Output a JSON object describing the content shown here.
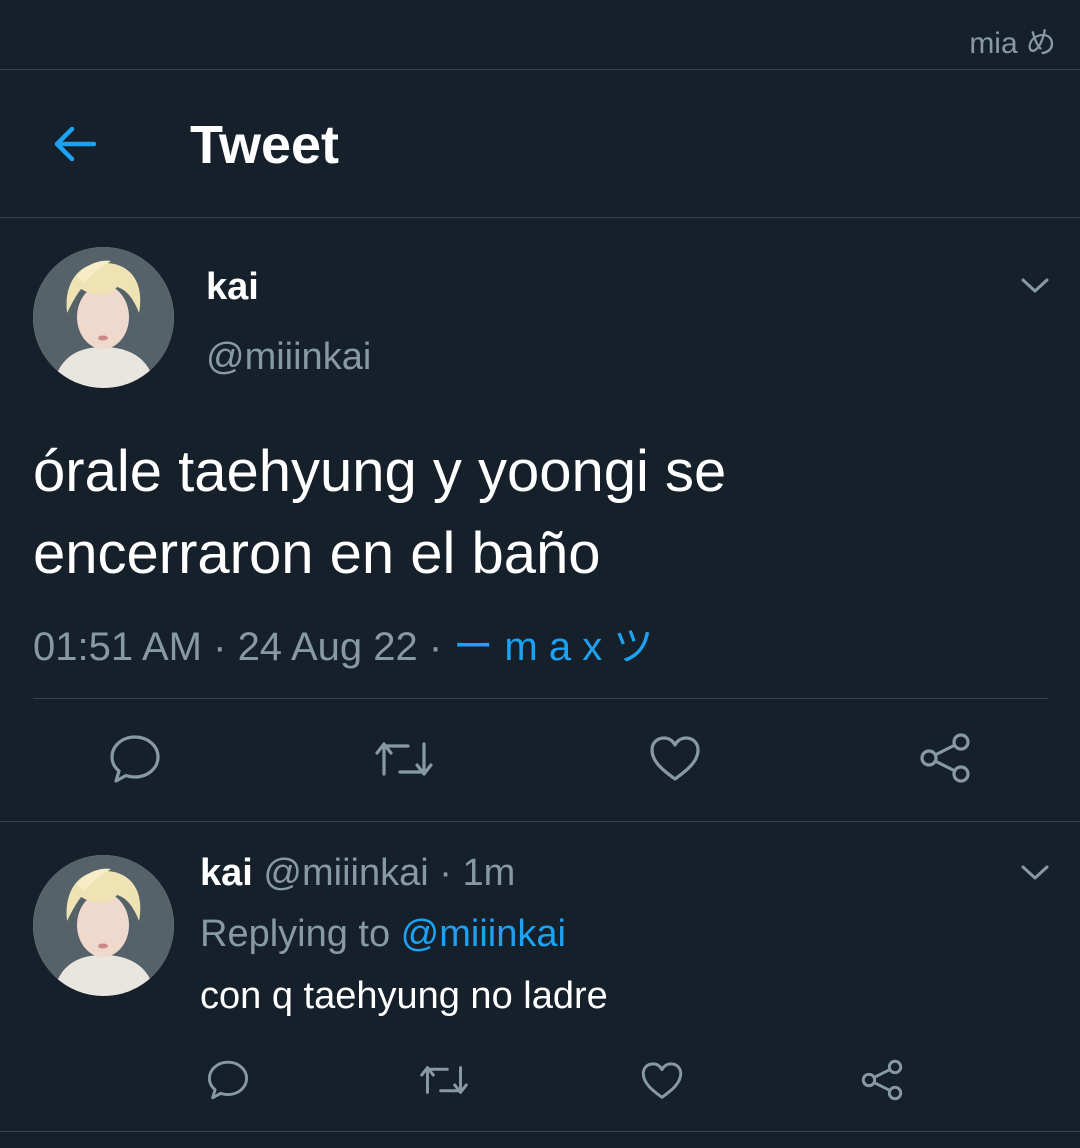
{
  "status_bar": {
    "watermark": "mia め"
  },
  "header": {
    "title": "Tweet"
  },
  "tweet": {
    "author_name": "kai",
    "author_handle": "@miiinkai",
    "text_line1": "órale taehyung y yoongi se",
    "text_line2": "encerraron en el baño",
    "time": "01:51 AM",
    "date": "24 Aug 22",
    "separator": " · ",
    "source": "ー m a x ツ"
  },
  "reply": {
    "author_name": "kai",
    "author_handle": "@miiinkai",
    "age": "1m",
    "separator": " · ",
    "replying_label": "Replying to ",
    "replying_handle": "@miiinkai",
    "text": "con q taehyung no ladre"
  },
  "colors": {
    "background": "#15202b",
    "divider": "#38444d",
    "secondary_text": "#8899a6",
    "accent": "#1da1f2",
    "icon": "#8899a6"
  },
  "icons": [
    "back-arrow-icon",
    "chevron-down-icon",
    "reply-icon",
    "retweet-icon",
    "like-icon",
    "share-icon"
  ]
}
